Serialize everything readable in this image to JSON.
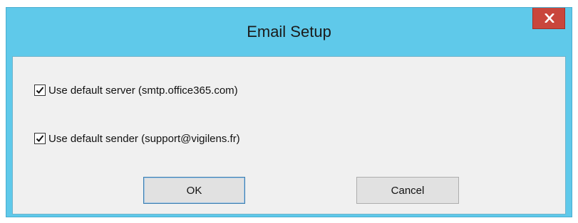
{
  "window": {
    "title": "Email Setup",
    "close_icon": "close-icon",
    "title_bar_color": "#5fc9ea",
    "close_button_color": "#c9463c"
  },
  "options": [
    {
      "label": "Use default server (smtp.office365.com)",
      "checked": true
    },
    {
      "label": "Use default sender (support@vigilens.fr)",
      "checked": true
    }
  ],
  "buttons": {
    "ok_label": "OK",
    "cancel_label": "Cancel"
  }
}
